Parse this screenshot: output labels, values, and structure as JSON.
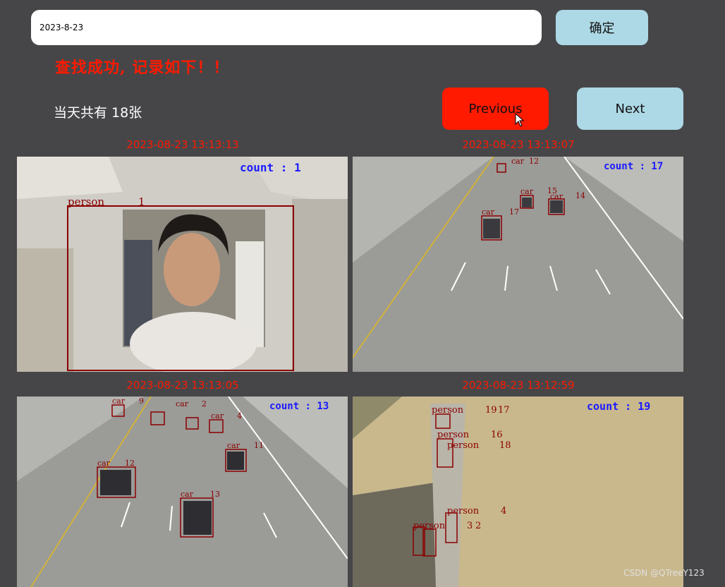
{
  "search": {
    "value": "2023-8-23",
    "confirm_label": "确定"
  },
  "status_text": "查找成功, 记录如下！！",
  "count_text": "当天共有 18张",
  "nav": {
    "previous_label": "Previous",
    "next_label": "Next"
  },
  "records": [
    {
      "timestamp": "2023-08-23 13:13:13",
      "count_label": "count : 1",
      "detections": [
        {
          "label": "person",
          "id": "1"
        }
      ]
    },
    {
      "timestamp": "2023-08-23 13:13:07",
      "count_label": "count : 17",
      "detections": [
        {
          "label": "car",
          "id": "12"
        },
        {
          "label": "car",
          "id": "15"
        },
        {
          "label": "car",
          "id": "14"
        },
        {
          "label": "car",
          "id": "17"
        }
      ]
    },
    {
      "timestamp": "2023-08-23 13:13:05",
      "count_label": "count : 13",
      "detections": [
        {
          "label": "car",
          "id": "9"
        },
        {
          "label": "car",
          "id": "2"
        },
        {
          "label": "car",
          "id": "4"
        },
        {
          "label": "car",
          "id": "11"
        },
        {
          "label": "car",
          "id": "12"
        },
        {
          "label": "car",
          "id": "13"
        }
      ]
    },
    {
      "timestamp": "2023-08-23 13:12:59",
      "count_label": "count : 19",
      "detections": [
        {
          "label": "person",
          "id": "19"
        },
        {
          "label": "person",
          "id": "17"
        },
        {
          "label": "person",
          "id": "16"
        },
        {
          "label": "person",
          "id": "18"
        },
        {
          "label": "person",
          "id": "4"
        },
        {
          "label": "person",
          "id": "3"
        },
        {
          "label": "person",
          "id": "2"
        }
      ]
    }
  ],
  "watermark": "CSDN @QTreeY123",
  "colors": {
    "accent_red": "#ff1a00",
    "button_blue": "#add8e6",
    "background": "#464649",
    "box": "#8b0000",
    "count_blue": "#1a1aff"
  }
}
